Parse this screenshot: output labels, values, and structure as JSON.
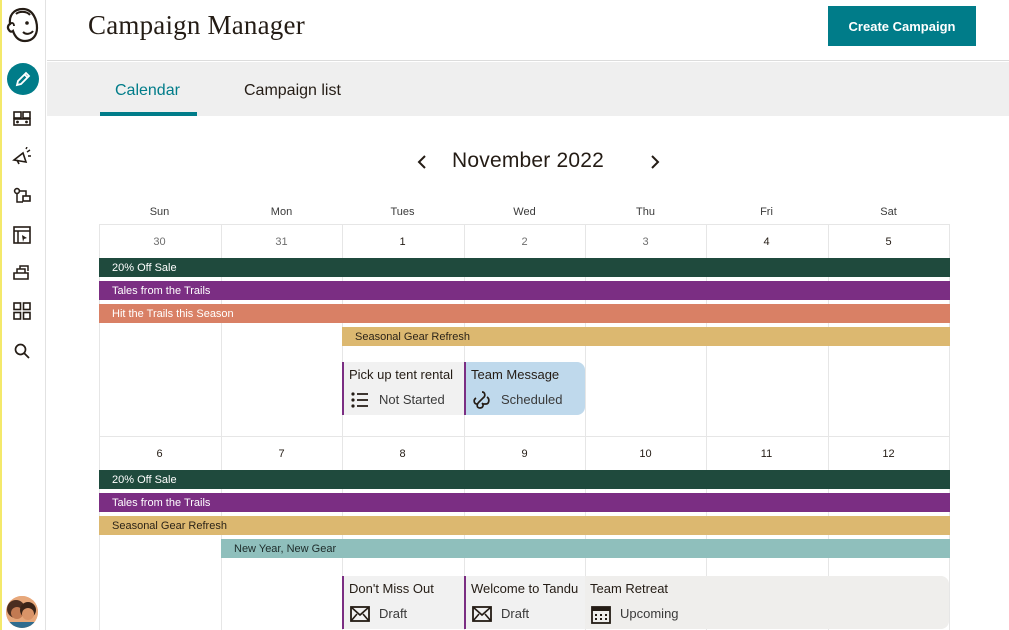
{
  "header": {
    "title": "Campaign Manager",
    "create_button": "Create Campaign"
  },
  "tabs": [
    {
      "label": "Calendar",
      "active": true
    },
    {
      "label": "Campaign list",
      "active": false
    }
  ],
  "calendar": {
    "month_label": "November 2022",
    "weekdays": [
      "Sun",
      "Mon",
      "Tues",
      "Wed",
      "Thu",
      "Fri",
      "Sat"
    ],
    "week1": {
      "days": [
        "30",
        "31",
        "1",
        "2",
        "3",
        "4",
        "5"
      ],
      "bars": [
        "20% Off Sale",
        "Tales from the Trails",
        "Hit the Trails this Season",
        "Seasonal Gear Refresh"
      ],
      "cards": [
        {
          "title": "Pick up tent rental",
          "status": "Not Started"
        },
        {
          "title": "Team Message",
          "status": "Scheduled"
        }
      ]
    },
    "week2": {
      "days": [
        "6",
        "7",
        "8",
        "9",
        "10",
        "11",
        "12"
      ],
      "bars": [
        "20% Off Sale",
        "Tales from the Trails",
        "Seasonal Gear Refresh",
        "New Year, New Gear"
      ],
      "cards": [
        {
          "title": "Don't Miss Out",
          "status": "Draft"
        },
        {
          "title": "Welcome to Tandu",
          "status": "Draft"
        },
        {
          "title": "Team Retreat",
          "status": "Upcoming"
        }
      ]
    }
  },
  "colors": {
    "accent": "#007c89",
    "bar_green": "#1f4a3d",
    "bar_purple": "#7b2e83",
    "bar_salmon": "#d98065",
    "bar_gold": "#dcb870",
    "bar_teal": "#8fbfbc",
    "card_blue": "#bfd9ec"
  },
  "icons": {
    "rail": [
      "mailchimp-logo-icon",
      "pencil-icon",
      "audience-icon",
      "megaphone-icon",
      "automation-icon",
      "website-icon",
      "content-icon",
      "grid-icon",
      "search-icon"
    ],
    "status": {
      "Not Started": "list-icon",
      "Scheduled": "sms-icon",
      "Draft": "envelope-icon",
      "Upcoming": "calendar-icon"
    }
  }
}
